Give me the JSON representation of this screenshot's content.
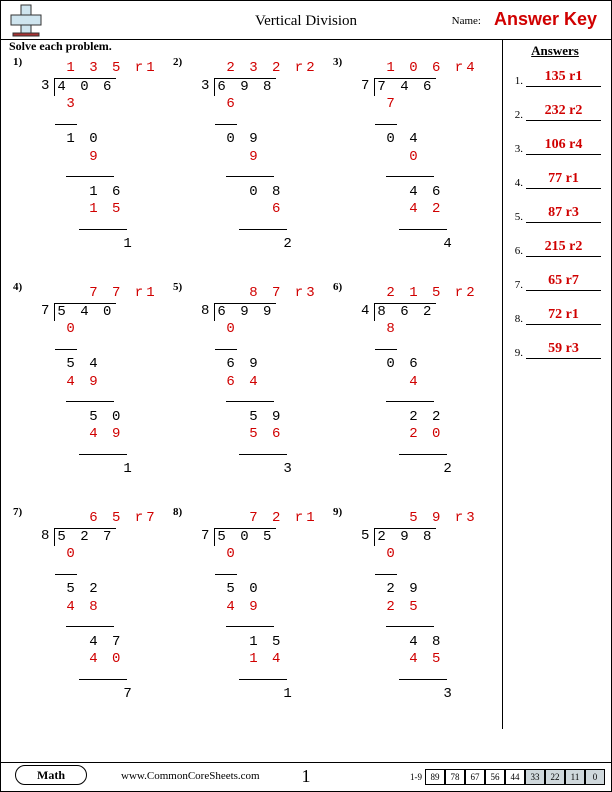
{
  "header": {
    "title": "Vertical Division",
    "name_label": "Name:",
    "answer_key": "Answer Key"
  },
  "instruction": "Solve each problem.",
  "answers_title": "Answers",
  "answers": [
    "135 r1",
    "232 r2",
    "106 r4",
    "77 r1",
    "87 r3",
    "215 r2",
    "65 r7",
    "72 r1",
    "59 r3"
  ],
  "problems": [
    {
      "n": "1)",
      "quotient": " 1 3 5 r1",
      "divisor": "3",
      "dividend": "4 0 6",
      "steps": [
        {
          "t": " 3",
          "c": "red",
          "rule": "11"
        },
        {
          "t": " 1 0",
          "c": "black"
        },
        {
          "t": "   9",
          "c": "red",
          "rule": "24",
          "ro": "11"
        },
        {
          "t": "   1 6",
          "c": "black"
        },
        {
          "t": "   1 5",
          "c": "red",
          "rule": "24",
          "ro": "24"
        },
        {
          "t": "      1",
          "c": "black"
        }
      ]
    },
    {
      "n": "2)",
      "quotient": " 2 3 2 r2",
      "divisor": "3",
      "dividend": "6 9 8",
      "steps": [
        {
          "t": " 6",
          "c": "red",
          "rule": "11"
        },
        {
          "t": " 0 9",
          "c": "black"
        },
        {
          "t": "   9",
          "c": "red",
          "rule": "24",
          "ro": "11"
        },
        {
          "t": "   0 8",
          "c": "black"
        },
        {
          "t": "     6",
          "c": "red",
          "rule": "24",
          "ro": "24"
        },
        {
          "t": "      2",
          "c": "black"
        }
      ]
    },
    {
      "n": "3)",
      "quotient": " 1 0 6 r4",
      "divisor": "7",
      "dividend": "7 4 6",
      "steps": [
        {
          "t": " 7",
          "c": "red",
          "rule": "11"
        },
        {
          "t": " 0 4",
          "c": "black"
        },
        {
          "t": "   0",
          "c": "red",
          "rule": "24",
          "ro": "11"
        },
        {
          "t": "   4 6",
          "c": "black"
        },
        {
          "t": "   4 2",
          "c": "red",
          "rule": "24",
          "ro": "24"
        },
        {
          "t": "      4",
          "c": "black"
        }
      ]
    },
    {
      "n": "4)",
      "quotient": "   7 7 r1",
      "divisor": "7",
      "dividend": "5 4 0",
      "steps": [
        {
          "t": " 0",
          "c": "red",
          "rule": "11"
        },
        {
          "t": " 5 4",
          "c": "black"
        },
        {
          "t": " 4 9",
          "c": "red",
          "rule": "24",
          "ro": "11"
        },
        {
          "t": "   5 0",
          "c": "black"
        },
        {
          "t": "   4 9",
          "c": "red",
          "rule": "24",
          "ro": "24"
        },
        {
          "t": "      1",
          "c": "black"
        }
      ]
    },
    {
      "n": "5)",
      "quotient": "   8 7 r3",
      "divisor": "8",
      "dividend": "6 9 9",
      "steps": [
        {
          "t": " 0",
          "c": "red",
          "rule": "11"
        },
        {
          "t": " 6 9",
          "c": "black"
        },
        {
          "t": " 6 4",
          "c": "red",
          "rule": "24",
          "ro": "11"
        },
        {
          "t": "   5 9",
          "c": "black"
        },
        {
          "t": "   5 6",
          "c": "red",
          "rule": "24",
          "ro": "24"
        },
        {
          "t": "      3",
          "c": "black"
        }
      ]
    },
    {
      "n": "6)",
      "quotient": " 2 1 5 r2",
      "divisor": "4",
      "dividend": "8 6 2",
      "steps": [
        {
          "t": " 8",
          "c": "red",
          "rule": "11"
        },
        {
          "t": " 0 6",
          "c": "black"
        },
        {
          "t": "   4",
          "c": "red",
          "rule": "24",
          "ro": "11"
        },
        {
          "t": "   2 2",
          "c": "black"
        },
        {
          "t": "   2 0",
          "c": "red",
          "rule": "24",
          "ro": "24"
        },
        {
          "t": "      2",
          "c": "black"
        }
      ]
    },
    {
      "n": "7)",
      "quotient": "   6 5 r7",
      "divisor": "8",
      "dividend": "5 2 7",
      "steps": [
        {
          "t": " 0",
          "c": "red",
          "rule": "11"
        },
        {
          "t": " 5 2",
          "c": "black"
        },
        {
          "t": " 4 8",
          "c": "red",
          "rule": "24",
          "ro": "11"
        },
        {
          "t": "   4 7",
          "c": "black"
        },
        {
          "t": "   4 0",
          "c": "red",
          "rule": "24",
          "ro": "24"
        },
        {
          "t": "      7",
          "c": "black"
        }
      ]
    },
    {
      "n": "8)",
      "quotient": "   7 2 r1",
      "divisor": "7",
      "dividend": "5 0 5",
      "steps": [
        {
          "t": " 0",
          "c": "red",
          "rule": "11"
        },
        {
          "t": " 5 0",
          "c": "black"
        },
        {
          "t": " 4 9",
          "c": "red",
          "rule": "24",
          "ro": "11"
        },
        {
          "t": "   1 5",
          "c": "black"
        },
        {
          "t": "   1 4",
          "c": "red",
          "rule": "24",
          "ro": "24"
        },
        {
          "t": "      1",
          "c": "black"
        }
      ]
    },
    {
      "n": "9)",
      "quotient": "   5 9 r3",
      "divisor": "5",
      "dividend": "2 9 8",
      "steps": [
        {
          "t": " 0",
          "c": "red",
          "rule": "11"
        },
        {
          "t": " 2 9",
          "c": "black"
        },
        {
          "t": " 2 5",
          "c": "red",
          "rule": "24",
          "ro": "11"
        },
        {
          "t": "   4 8",
          "c": "black"
        },
        {
          "t": "   4 5",
          "c": "red",
          "rule": "24",
          "ro": "24"
        },
        {
          "t": "      3",
          "c": "black"
        }
      ]
    }
  ],
  "footer": {
    "math": "Math",
    "site": "www.CommonCoreSheets.com",
    "page": "1",
    "score_label": "1-9",
    "scores": [
      "89",
      "78",
      "67",
      "56",
      "44",
      "33",
      "22",
      "11",
      "0"
    ],
    "shade_from": 5
  }
}
